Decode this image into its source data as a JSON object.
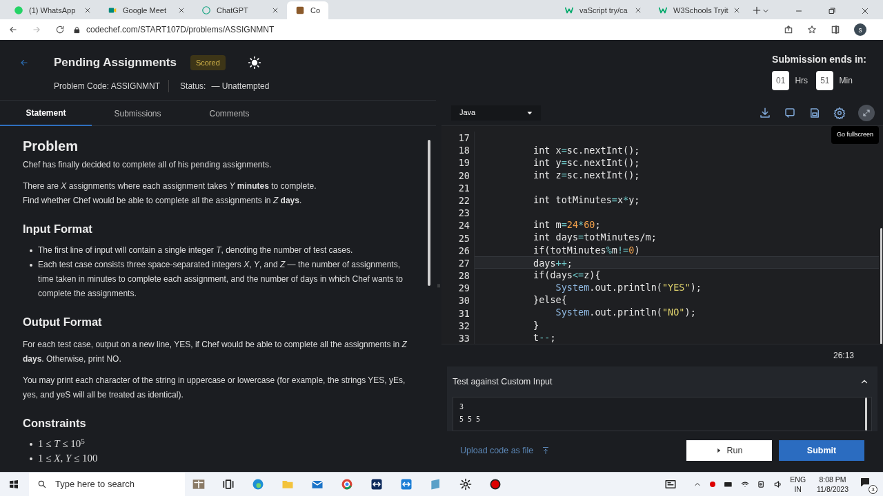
{
  "browser": {
    "tabs": [
      {
        "title": "(1) WhatsApp",
        "kind": "whatsapp",
        "selected": false
      },
      {
        "title": "Google Meet",
        "kind": "meet",
        "selected": false
      },
      {
        "title": "ChatGPT",
        "kind": "chatgpt",
        "selected": false
      },
      {
        "title": "Co",
        "kind": "codechef",
        "selected": true
      },
      {
        "title": "vaScript try/ca",
        "kind": "w3",
        "selected": false
      },
      {
        "title": "W3Schools Tryit",
        "kind": "w3",
        "selected": false
      }
    ],
    "url": "codechef.com/START107D/problems/ASSIGNMNT",
    "profile": "s"
  },
  "header": {
    "title": "Pending Assignments",
    "badge": "Scored",
    "problem_code": "Problem Code: ASSIGNMNT",
    "status_label": "Status:",
    "status_value": "— Unattempted",
    "timer_label": "Submission ends in:",
    "hours": "01",
    "hours_unit": "Hrs",
    "minutes": "51",
    "minutes_unit": "Min"
  },
  "tabs": [
    {
      "label": "Statement",
      "selected": true
    },
    {
      "label": "Submissions",
      "selected": false
    },
    {
      "label": "Comments",
      "selected": false
    }
  ],
  "statement": [
    {
      "kind": "title",
      "text": "Problem"
    },
    {
      "kind": "para",
      "lines": [
        "Chef has finally decided to complete all of his pending assignments."
      ]
    },
    {
      "kind": "para",
      "lines": [
        "There are *X* assignments where each assignment takes *Y* **minutes** to complete.",
        "Find whether Chef would be able to complete all the assignments in *Z* **days**."
      ]
    },
    {
      "kind": "heading",
      "text": "Input Format"
    },
    {
      "kind": "bullets",
      "items": [
        "The first line of input will contain a single integer *T*, denoting the number of test cases.",
        "Each test case consists three space-separated integers *X*, *Y*, and *Z* — the number of assignments, time taken in minutes to complete each assignment, and the number of days in which Chef wants to complete the assignments."
      ]
    },
    {
      "kind": "heading",
      "text": "Output Format"
    },
    {
      "kind": "para",
      "lines": [
        "For each test case, output on a new line, YES, if Chef would be able to complete all the assignments in *Z* **days**. Otherwise, print NO."
      ]
    },
    {
      "kind": "para",
      "lines": [
        "You may print each character of the string in uppercase or lowercase (for example, the strings YES, yEs, yes, and yeS will all be treated as identical)."
      ]
    },
    {
      "kind": "heading",
      "text": "Constraints"
    },
    {
      "kind": "math",
      "items": [
        "1 ≤ *T* ≤ 10$^{5}$",
        "1 ≤ *X*, *Y* ≤ 100"
      ]
    }
  ],
  "editor": {
    "language": "Java",
    "tooltip": "Go fullscreen",
    "cursor_position": "26:13",
    "lines": [
      {
        "n": "17",
        "current": false
      },
      {
        "n": "18",
        "current": false,
        "tokens": [
          {
            "kind": "plain",
            "text": "        int x"
          },
          {
            "kind": "operator",
            "text": "="
          },
          {
            "kind": "plain",
            "text": "sc.nextInt();"
          }
        ]
      },
      {
        "n": "19",
        "current": false,
        "tokens": [
          {
            "kind": "plain",
            "text": "        int y"
          },
          {
            "kind": "operator",
            "text": "="
          },
          {
            "kind": "plain",
            "text": "sc.nextInt();"
          }
        ]
      },
      {
        "n": "20",
        "current": false,
        "tokens": [
          {
            "kind": "plain",
            "text": "        int z"
          },
          {
            "kind": "operator",
            "text": "="
          },
          {
            "kind": "plain",
            "text": "sc.nextInt();"
          }
        ]
      },
      {
        "n": "21",
        "current": false
      },
      {
        "n": "22",
        "current": false,
        "tokens": [
          {
            "kind": "plain",
            "text": "        int totMinutes"
          },
          {
            "kind": "operator",
            "text": "="
          },
          {
            "kind": "plain",
            "text": "x"
          },
          {
            "kind": "operator",
            "text": "*"
          },
          {
            "kind": "plain",
            "text": "y;"
          }
        ]
      },
      {
        "n": "23",
        "current": false
      },
      {
        "n": "24",
        "current": false,
        "tokens": [
          {
            "kind": "plain",
            "text": "        int m"
          },
          {
            "kind": "operator",
            "text": "="
          },
          {
            "kind": "number",
            "text": "24"
          },
          {
            "kind": "operator",
            "text": "*"
          },
          {
            "kind": "number",
            "text": "60"
          },
          {
            "kind": "plain",
            "text": ";"
          }
        ]
      },
      {
        "n": "25",
        "current": false,
        "tokens": [
          {
            "kind": "plain",
            "text": "        int days"
          },
          {
            "kind": "operator",
            "text": "="
          },
          {
            "kind": "plain",
            "text": "totMinutes/m;"
          }
        ]
      },
      {
        "n": "26",
        "current": false,
        "tokens": [
          {
            "kind": "plain",
            "text": "        if(totMinutes"
          },
          {
            "kind": "operator",
            "text": "%"
          },
          {
            "kind": "plain",
            "text": "m"
          },
          {
            "kind": "operator",
            "text": "!="
          },
          {
            "kind": "number",
            "text": "0"
          },
          {
            "kind": "plain",
            "text": ")"
          }
        ]
      },
      {
        "n": "27",
        "current": true,
        "tokens": [
          {
            "kind": "plain",
            "text": "        days"
          },
          {
            "kind": "operator",
            "text": "++"
          },
          {
            "kind": "plain",
            "text": ";"
          }
        ]
      },
      {
        "n": "28",
        "current": false,
        "tokens": [
          {
            "kind": "plain",
            "text": "        if(days"
          },
          {
            "kind": "operator",
            "text": "<="
          },
          {
            "kind": "plain",
            "text": "z){"
          }
        ]
      },
      {
        "n": "29",
        "current": false,
        "tokens": [
          {
            "kind": "class",
            "text": "            System"
          },
          {
            "kind": "plain",
            "text": ".out.println("
          },
          {
            "kind": "string",
            "text": "\"YES\""
          },
          {
            "kind": "plain",
            "text": ");"
          }
        ]
      },
      {
        "n": "30",
        "current": false,
        "tokens": [
          {
            "kind": "plain",
            "text": "        }else{"
          }
        ]
      },
      {
        "n": "31",
        "current": false,
        "tokens": [
          {
            "kind": "class",
            "text": "            System"
          },
          {
            "kind": "plain",
            "text": ".out.println("
          },
          {
            "kind": "string",
            "text": "\"NO\""
          },
          {
            "kind": "plain",
            "text": ");"
          }
        ]
      },
      {
        "n": "32",
        "current": false,
        "tokens": [
          {
            "kind": "plain",
            "text": "        }"
          }
        ]
      },
      {
        "n": "33",
        "current": false,
        "tokens": [
          {
            "kind": "plain",
            "text": "        t"
          },
          {
            "kind": "operator",
            "text": "--"
          },
          {
            "kind": "plain",
            "text": ";"
          }
        ]
      }
    ]
  },
  "custom_input": {
    "title": "Test against Custom Input",
    "expanded": true,
    "lines": [
      "3",
      "5 5 5"
    ]
  },
  "actions": {
    "upload": "Upload code as file",
    "run": "Run",
    "submit": "Submit"
  },
  "taskbar": {
    "search_placeholder": "Type here to search",
    "lang_top": "ENG",
    "lang_bottom": "IN",
    "time": "8:08 PM",
    "date": "11/8/2023",
    "notifications": "3"
  }
}
